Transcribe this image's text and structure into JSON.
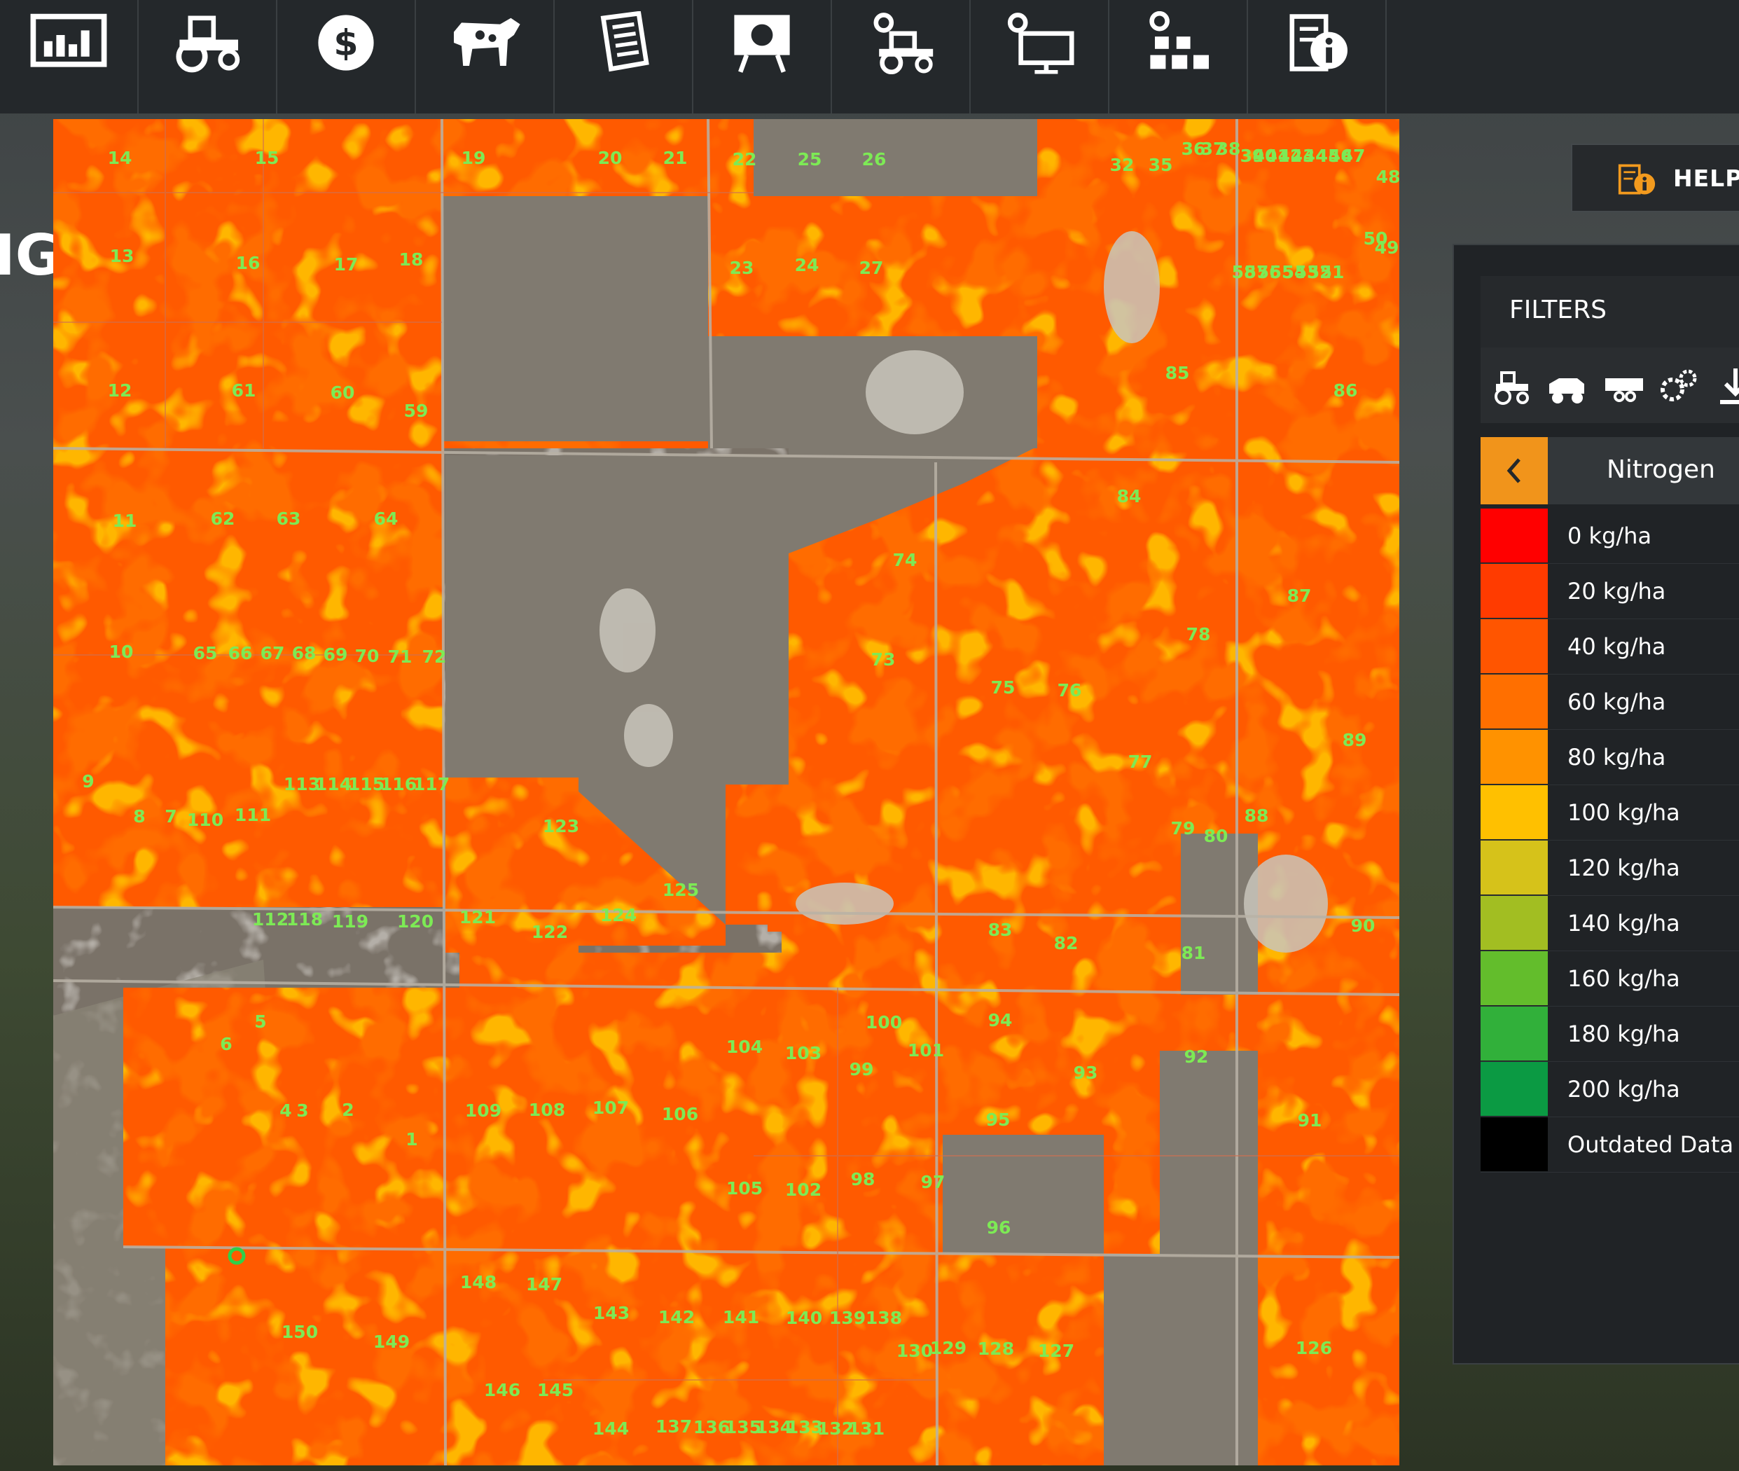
{
  "background": {
    "title_fragment": "IG"
  },
  "toolbar": {
    "tabs": [
      {
        "icon": "statistics-icon"
      },
      {
        "icon": "tractor-icon"
      },
      {
        "icon": "finances-icon"
      },
      {
        "icon": "animals-icon"
      },
      {
        "icon": "contracts-icon"
      },
      {
        "icon": "training-icon"
      },
      {
        "icon": "production-icon"
      },
      {
        "icon": "settings-icon"
      },
      {
        "icon": "buildings-icon"
      },
      {
        "icon": "info-icon"
      }
    ]
  },
  "help": {
    "label": "HELP"
  },
  "panel": {
    "title": "FILTERS",
    "layer": "Nitrogen",
    "legend": [
      {
        "label": "0 kg/ha",
        "color": "#ff0000"
      },
      {
        "label": "20 kg/ha",
        "color": "#ff3b00"
      },
      {
        "label": "40 kg/ha",
        "color": "#ff5500"
      },
      {
        "label": "60 kg/ha",
        "color": "#ff6f00"
      },
      {
        "label": "80 kg/ha",
        "color": "#ff9200"
      },
      {
        "label": "100 kg/ha",
        "color": "#ffc000"
      },
      {
        "label": "120 kg/ha",
        "color": "#d6c21a"
      },
      {
        "label": "140 kg/ha",
        "color": "#a2be22"
      },
      {
        "label": "160 kg/ha",
        "color": "#63bd2c"
      },
      {
        "label": "180 kg/ha",
        "color": "#31b03a"
      },
      {
        "label": "200 kg/ha",
        "color": "#0b9a43"
      },
      {
        "label": "Outdated Data",
        "color": "#000000"
      }
    ]
  },
  "map": {
    "field_labels": [
      {
        "t": "14"
      },
      {
        "t": "15"
      },
      {
        "t": "19"
      },
      {
        "t": "20"
      },
      {
        "t": "21"
      },
      {
        "t": "22"
      },
      {
        "t": "25"
      },
      {
        "t": "26"
      },
      {
        "t": "32"
      },
      {
        "t": "35"
      },
      {
        "t": "36"
      },
      {
        "t": "37"
      },
      {
        "t": "38"
      },
      {
        "t": "39"
      },
      {
        "t": "40"
      },
      {
        "t": "41"
      },
      {
        "t": "42"
      },
      {
        "t": "43"
      },
      {
        "t": "44"
      },
      {
        "t": "45"
      },
      {
        "t": "46"
      },
      {
        "t": "47"
      },
      {
        "t": "48"
      },
      {
        "t": "13"
      },
      {
        "t": "16"
      },
      {
        "t": "17"
      },
      {
        "t": "18"
      },
      {
        "t": "23"
      },
      {
        "t": "24"
      },
      {
        "t": "27"
      },
      {
        "t": "50"
      },
      {
        "t": "49"
      },
      {
        "t": "58"
      },
      {
        "t": "57"
      },
      {
        "t": "56"
      },
      {
        "t": "55"
      },
      {
        "t": "54"
      },
      {
        "t": "53"
      },
      {
        "t": "52"
      },
      {
        "t": "51"
      },
      {
        "t": "12"
      },
      {
        "t": "61"
      },
      {
        "t": "60"
      },
      {
        "t": "59"
      },
      {
        "t": "85"
      },
      {
        "t": "86"
      },
      {
        "t": "11"
      },
      {
        "t": "62"
      },
      {
        "t": "63"
      },
      {
        "t": "64"
      },
      {
        "t": "84"
      },
      {
        "t": "74"
      },
      {
        "t": "87"
      },
      {
        "t": "10"
      },
      {
        "t": "65"
      },
      {
        "t": "66"
      },
      {
        "t": "67"
      },
      {
        "t": "68"
      },
      {
        "t": "69"
      },
      {
        "t": "70"
      },
      {
        "t": "71"
      },
      {
        "t": "72"
      },
      {
        "t": "73"
      },
      {
        "t": "78"
      },
      {
        "t": "75"
      },
      {
        "t": "76"
      },
      {
        "t": "89"
      },
      {
        "t": "77"
      },
      {
        "t": "9"
      },
      {
        "t": "113"
      },
      {
        "t": "114"
      },
      {
        "t": "115"
      },
      {
        "t": "116"
      },
      {
        "t": "117"
      },
      {
        "t": "8"
      },
      {
        "t": "7"
      },
      {
        "t": "110"
      },
      {
        "t": "111"
      },
      {
        "t": "123"
      },
      {
        "t": "79"
      },
      {
        "t": "80"
      },
      {
        "t": "88"
      },
      {
        "t": "125"
      },
      {
        "t": "112"
      },
      {
        "t": "118"
      },
      {
        "t": "119"
      },
      {
        "t": "120"
      },
      {
        "t": "121"
      },
      {
        "t": "122"
      },
      {
        "t": "124"
      },
      {
        "t": "83"
      },
      {
        "t": "82"
      },
      {
        "t": "90"
      },
      {
        "t": "81"
      },
      {
        "t": "5"
      },
      {
        "t": "6"
      },
      {
        "t": "100"
      },
      {
        "t": "94"
      },
      {
        "t": "104"
      },
      {
        "t": "103"
      },
      {
        "t": "101"
      },
      {
        "t": "99"
      },
      {
        "t": "93"
      },
      {
        "t": "92"
      },
      {
        "t": "4"
      },
      {
        "t": "3"
      },
      {
        "t": "2"
      },
      {
        "t": "1"
      },
      {
        "t": "109"
      },
      {
        "t": "108"
      },
      {
        "t": "107"
      },
      {
        "t": "106"
      },
      {
        "t": "95"
      },
      {
        "t": "91"
      },
      {
        "t": "105"
      },
      {
        "t": "102"
      },
      {
        "t": "98"
      },
      {
        "t": "97"
      },
      {
        "t": "96"
      },
      {
        "t": "148"
      },
      {
        "t": "147"
      },
      {
        "t": "150"
      },
      {
        "t": "149"
      },
      {
        "t": "143"
      },
      {
        "t": "142"
      },
      {
        "t": "141"
      },
      {
        "t": "140"
      },
      {
        "t": "139"
      },
      {
        "t": "138"
      },
      {
        "t": "130"
      },
      {
        "t": "129"
      },
      {
        "t": "128"
      },
      {
        "t": "127"
      },
      {
        "t": "126"
      },
      {
        "t": "146"
      },
      {
        "t": "145"
      },
      {
        "t": "144"
      },
      {
        "t": "137"
      },
      {
        "t": "136"
      },
      {
        "t": "135"
      },
      {
        "t": "134"
      },
      {
        "t": "133"
      },
      {
        "t": "132"
      },
      {
        "t": "131"
      }
    ]
  }
}
